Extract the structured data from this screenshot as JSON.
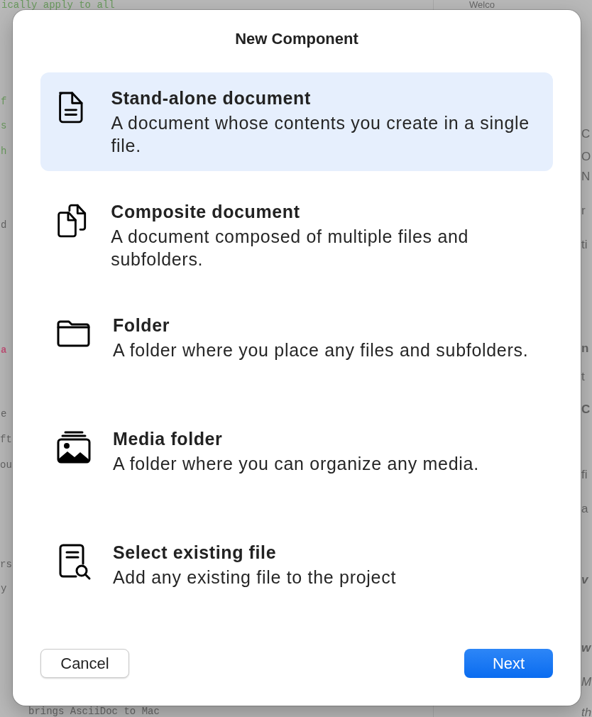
{
  "background": {
    "left_lines": [
      {
        "text": "ically apply to all",
        "kind": "comment"
      },
      {
        "text": "f",
        "kind": "comment"
      },
      {
        "text": "s",
        "kind": "comment"
      },
      {
        "text": "h",
        "kind": "comment"
      },
      {
        "text": "d",
        "kind": "plain"
      },
      {
        "text": "a",
        "kind": "emphasis"
      },
      {
        "text": "e",
        "kind": "plain"
      },
      {
        "text": "ft",
        "kind": "plain"
      },
      {
        "text": "ou",
        "kind": "plain"
      },
      {
        "text": "rs",
        "kind": "plain"
      },
      {
        "text": "y",
        "kind": "plain"
      },
      {
        "text": "brings AsciiDoc to Mac",
        "kind": "plain"
      }
    ],
    "right_lines": [
      {
        "text": "Welco",
        "kind": "heading"
      },
      {
        "text": "C",
        "kind": "plain"
      },
      {
        "text": "O",
        "kind": "plain"
      },
      {
        "text": "N",
        "kind": "plain"
      },
      {
        "text": "r",
        "kind": "plain"
      },
      {
        "text": "ti",
        "kind": "plain"
      },
      {
        "text": "n",
        "kind": "bold"
      },
      {
        "text": "t",
        "kind": "plain"
      },
      {
        "text": "C",
        "kind": "bold"
      },
      {
        "text": "fi",
        "kind": "plain"
      },
      {
        "text": "a",
        "kind": "plain"
      },
      {
        "text": "v",
        "kind": "bolditalic"
      },
      {
        "text": "w",
        "kind": "bolditalic"
      },
      {
        "text": "M",
        "kind": "italic"
      },
      {
        "text": "th",
        "kind": "italic"
      }
    ]
  },
  "dialog": {
    "title": "New Component",
    "options": [
      {
        "kind": "document",
        "title": "Stand-alone document",
        "description": "A document whose contents you create in a single file.",
        "selected": true
      },
      {
        "kind": "composite",
        "title": "Composite document",
        "description": "A document composed of multiple files and subfolders.",
        "selected": false
      },
      {
        "kind": "folder",
        "title": "Folder",
        "description": "A folder where you place any files and subfolders.",
        "selected": false
      },
      {
        "kind": "media",
        "title": "Media folder",
        "description": "A folder where you can organize any media.",
        "selected": false
      },
      {
        "kind": "existing",
        "title": "Select existing file",
        "description": "Add any existing file to the project",
        "selected": false
      }
    ],
    "cancel": "Cancel",
    "next": "Next"
  }
}
